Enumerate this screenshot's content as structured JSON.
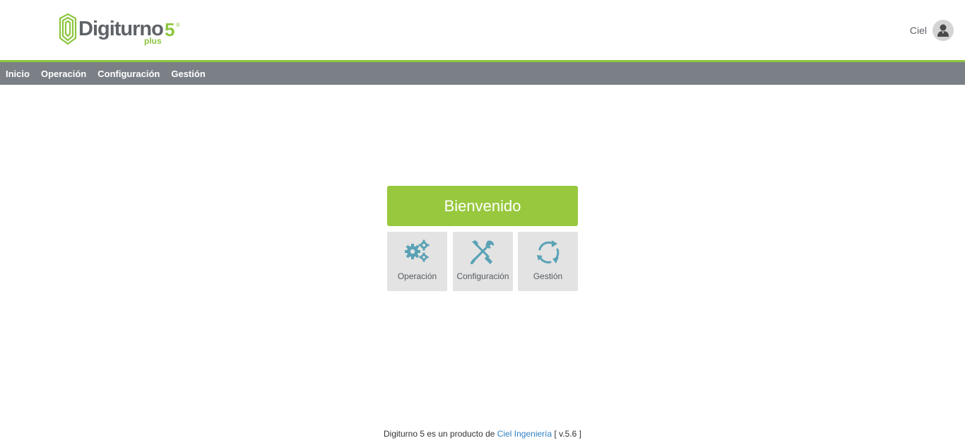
{
  "header": {
    "logo": {
      "name": "Digiturno",
      "version": "5",
      "registered": "®",
      "edition": "plus"
    },
    "user": {
      "name": "Ciel",
      "avatar_icon": "user-icon"
    }
  },
  "nav": {
    "items": [
      {
        "label": "Inicio"
      },
      {
        "label": "Operación"
      },
      {
        "label": "Configuración"
      },
      {
        "label": "Gestión"
      }
    ]
  },
  "main": {
    "welcome": "Bienvenido",
    "tiles": [
      {
        "label": "Operación",
        "icon": "gears-icon"
      },
      {
        "label": "Configuración",
        "icon": "tools-icon"
      },
      {
        "label": "Gestión",
        "icon": "refresh-icon"
      }
    ]
  },
  "footer": {
    "prefix": "Digiturno 5 es un producto de",
    "link": "Ciel Ingeniería",
    "version": "[ v.5.6 ]"
  },
  "colors": {
    "accent_green": "#97c83d",
    "nav_gray": "#7b8087",
    "icon_blue": "#5aa2b5",
    "link_blue": "#2f7fc1"
  }
}
